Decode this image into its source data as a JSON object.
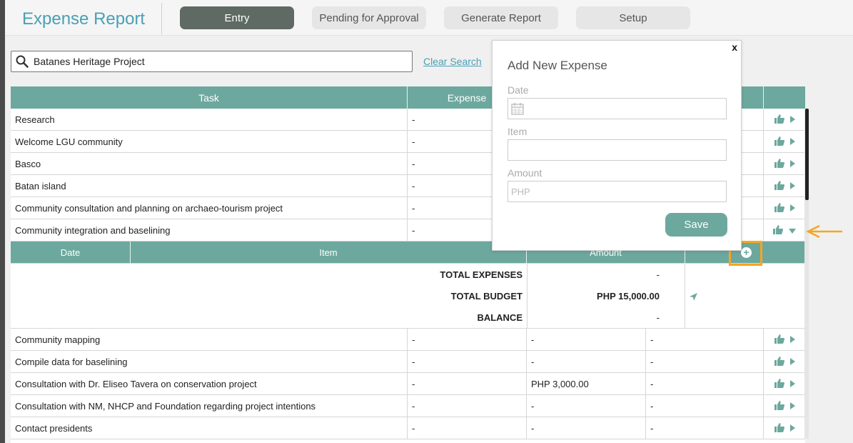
{
  "app": {
    "title": "Expense Report"
  },
  "nav": {
    "tabs": [
      "Entry",
      "Pending for Approval",
      "Generate Report",
      "Setup"
    ],
    "active": "Entry"
  },
  "search": {
    "value": "Batanes Heritage Project",
    "clear_label": "Clear Search"
  },
  "table": {
    "headers": {
      "task": "Task",
      "expense": "Expense"
    },
    "rows_top": [
      {
        "task": "Research",
        "expense": "-"
      },
      {
        "task": "Welcome LGU community",
        "expense": "-"
      },
      {
        "task": "Basco",
        "expense": "-"
      },
      {
        "task": "Batan island",
        "expense": "-"
      },
      {
        "task": "Community consultation and planning on archaeo-tourism project",
        "expense": "-"
      },
      {
        "task": "Community integration and baselining",
        "expense": "-"
      }
    ],
    "sub_headers": {
      "date": "Date",
      "item": "Item",
      "amount": "Amount"
    },
    "totals": {
      "expenses_label": "TOTAL EXPENSES",
      "expenses_value": "-",
      "budget_label": "TOTAL BUDGET",
      "budget_value": "PHP 15,000.00",
      "balance_label": "BALANCE",
      "balance_value": "-"
    },
    "rows_bottom": [
      {
        "task": "Community mapping",
        "c2": "-",
        "c3": "-",
        "c4": "-"
      },
      {
        "task": "Compile data for baselining",
        "c2": "-",
        "c3": "-",
        "c4": "-"
      },
      {
        "task": "Consultation with Dr. Eliseo Tavera on conservation project",
        "c2": "-",
        "c3": "PHP 3,000.00",
        "c4": "-"
      },
      {
        "task": "Consultation with NM, NHCP and Foundation regarding project intentions",
        "c2": "-",
        "c3": "-",
        "c4": "-"
      },
      {
        "task": "Contact presidents",
        "c2": "-",
        "c3": "-",
        "c4": "-"
      }
    ]
  },
  "modal": {
    "close": "x",
    "title": "Add New Expense",
    "date_label": "Date",
    "item_label": "Item",
    "amount_label": "Amount",
    "amount_placeholder": "PHP",
    "save_label": "Save"
  },
  "colors": {
    "accent": "#6ca89e",
    "brand": "#4aa0b5",
    "annotation": "#f5a623",
    "active_tab": "#5e6a63"
  }
}
